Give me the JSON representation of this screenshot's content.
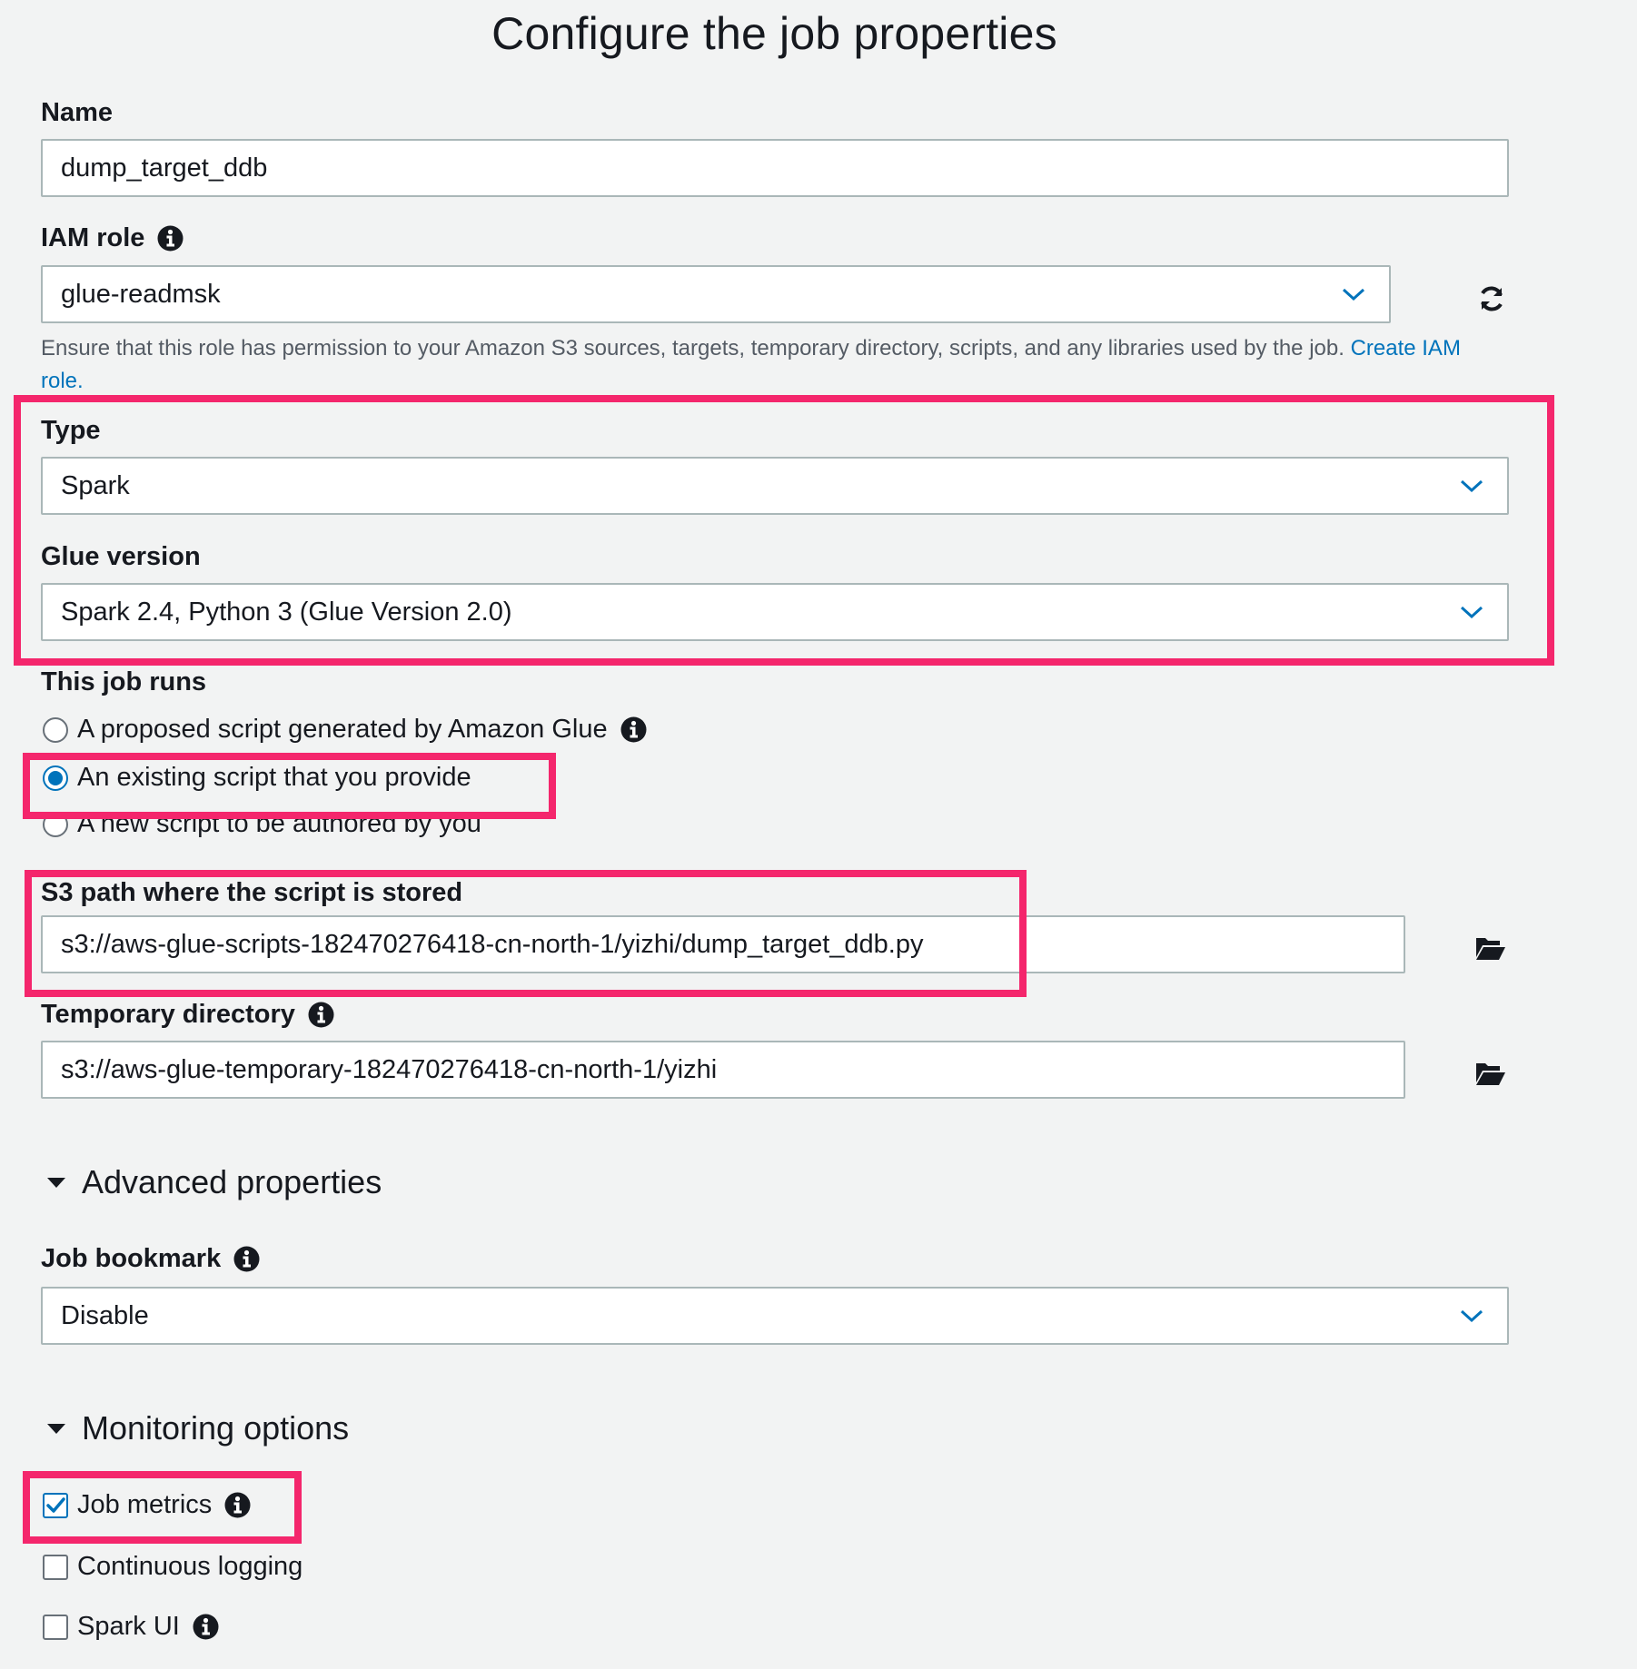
{
  "page_title": "Configure the job properties",
  "name": {
    "label": "Name",
    "value": "dump_target_ddb"
  },
  "iam_role": {
    "label": "IAM role",
    "value": "glue-readmsk",
    "help_text": "Ensure that this role has permission to your Amazon S3 sources, targets, temporary directory, scripts, and any libraries used by the job.",
    "help_link_line1": "Create IAM",
    "help_link_line2": "role."
  },
  "type": {
    "label": "Type",
    "value": "Spark"
  },
  "glue_version": {
    "label": "Glue version",
    "value": "Spark 2.4, Python 3 (Glue Version 2.0)"
  },
  "job_runs": {
    "label": "This job runs",
    "options": [
      {
        "label": "A proposed script generated by Amazon Glue",
        "selected": false
      },
      {
        "label": "An existing script that you provide",
        "selected": true
      },
      {
        "label": "A new script to be authored by you",
        "selected": false
      }
    ]
  },
  "s3_script_path": {
    "label": "S3 path where the script is stored",
    "value": "s3://aws-glue-scripts-182470276418-cn-north-1/yizhi/dump_target_ddb.py"
  },
  "temp_dir": {
    "label": "Temporary directory",
    "value": "s3://aws-glue-temporary-182470276418-cn-north-1/yizhi"
  },
  "advanced": {
    "title": "Advanced properties",
    "job_bookmark": {
      "label": "Job bookmark",
      "value": "Disable"
    }
  },
  "monitoring": {
    "title": "Monitoring options",
    "options": [
      {
        "label": "Job metrics",
        "checked": true
      },
      {
        "label": "Continuous logging",
        "checked": false
      },
      {
        "label": "Spark UI",
        "checked": false
      }
    ]
  },
  "colors": {
    "accent": "#0073bb",
    "highlight": "#f4266c",
    "background": "#f2f3f3"
  },
  "icons": {
    "info": "info-icon",
    "refresh": "refresh-icon",
    "folder": "folder-open-icon",
    "dropdown": "chevron-down-icon"
  }
}
